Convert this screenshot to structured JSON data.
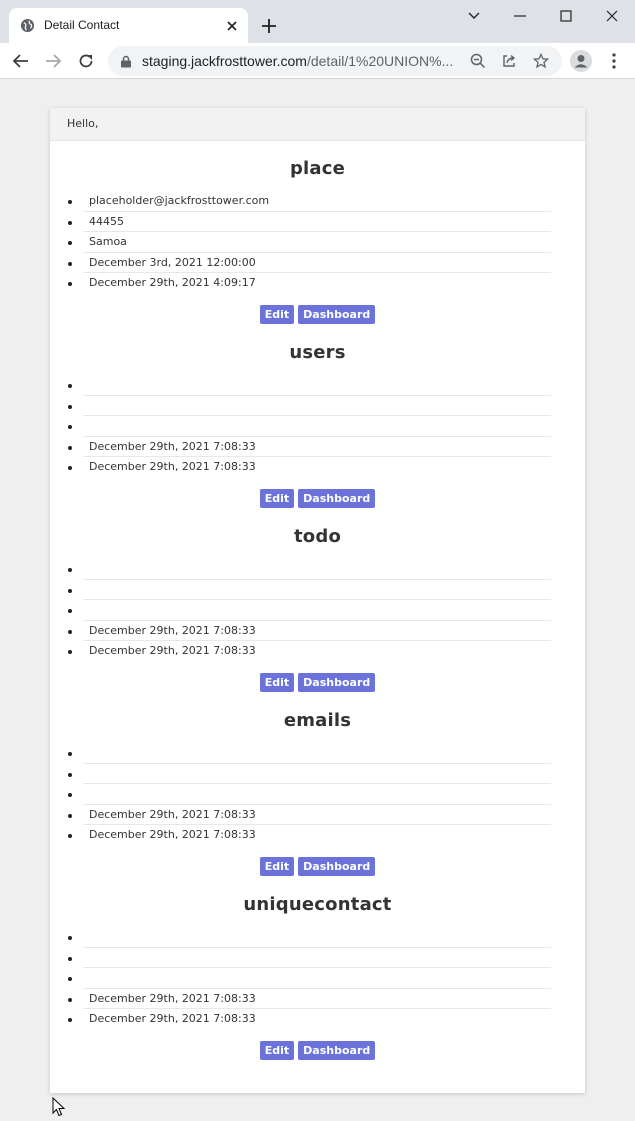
{
  "browser": {
    "tab_title": "Detail Contact",
    "url_host": "staging.jackfrosttower.com",
    "url_path": "/detail/1%20UNION%..."
  },
  "page": {
    "greeting": "Hello,",
    "sections": [
      {
        "title": "place",
        "items": [
          "placeholder@jackfrosttower.com",
          "44455",
          "Samoa",
          "December 3rd, 2021 12:00:00",
          "December 29th, 2021 4:09:17"
        ],
        "edit_label": "Edit",
        "dashboard_label": "Dashboard"
      },
      {
        "title": "users",
        "items": [
          "",
          "",
          "",
          "December 29th, 2021 7:08:33",
          "December 29th, 2021 7:08:33"
        ],
        "edit_label": "Edit",
        "dashboard_label": "Dashboard"
      },
      {
        "title": "todo",
        "items": [
          "",
          "",
          "",
          "December 29th, 2021 7:08:33",
          "December 29th, 2021 7:08:33"
        ],
        "edit_label": "Edit",
        "dashboard_label": "Dashboard"
      },
      {
        "title": "emails",
        "items": [
          "",
          "",
          "",
          "December 29th, 2021 7:08:33",
          "December 29th, 2021 7:08:33"
        ],
        "edit_label": "Edit",
        "dashboard_label": "Dashboard"
      },
      {
        "title": "uniquecontact",
        "items": [
          "",
          "",
          "",
          "December 29th, 2021 7:08:33",
          "December 29th, 2021 7:08:33"
        ],
        "edit_label": "Edit",
        "dashboard_label": "Dashboard"
      }
    ]
  },
  "colors": {
    "button_bg": "#6b73db",
    "page_bg": "#efefef",
    "tabstrip_bg": "#dee1e6"
  },
  "icons": {
    "favicon": "globe-icon",
    "tab_close": "close-icon",
    "new_tab": "plus-icon",
    "back": "arrow-left-icon",
    "forward": "arrow-right-icon",
    "reload": "reload-icon",
    "lock": "lock-icon",
    "zoom": "zoom-out-icon",
    "share": "share-icon",
    "bookmark": "star-icon",
    "profile": "profile-icon",
    "menu": "kebab-menu-icon"
  }
}
